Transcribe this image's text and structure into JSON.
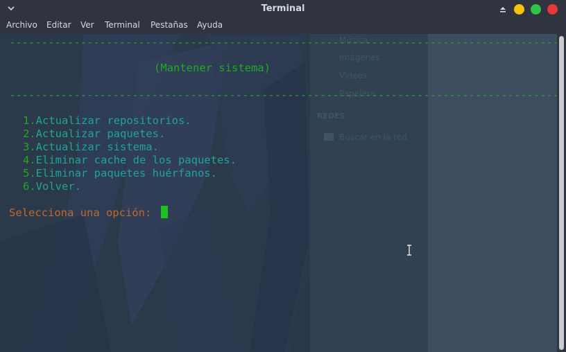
{
  "window": {
    "title": "Terminal",
    "colors": {
      "minimize": "#f5c211",
      "maximize": "#30c24b",
      "close": "#e5393b",
      "chrome": "#2f343f"
    }
  },
  "menubar": {
    "items": [
      "Archivo",
      "Editar",
      "Ver",
      "Terminal",
      "Pestañas",
      "Ayuda"
    ]
  },
  "background_ghost": {
    "items": [
      "Música",
      "Imágenes",
      "Vídeos",
      "Papelera"
    ],
    "section": "REDES",
    "network_item": "Buscar en la red"
  },
  "terminal": {
    "rule": "-------------------------------------------------------------------------------------",
    "heading": "(Mantener sistema)",
    "options": [
      {
        "num": "1.",
        "label": "Actualizar repositorios."
      },
      {
        "num": "2.",
        "label": "Actualizar paquetes."
      },
      {
        "num": "3.",
        "label": "Actualizar sistema."
      },
      {
        "num": "4.",
        "label": "Eliminar cache de los paquetes."
      },
      {
        "num": "5.",
        "label": "Eliminar paquetes huérfanos."
      },
      {
        "num": "6.",
        "label": "Volver."
      }
    ],
    "prompt": "Selecciona una opción: ",
    "colors": {
      "rule": "#1faa1f",
      "number": "#1faa1f",
      "option": "#20a39b",
      "prompt": "#c0682e",
      "cursor": "#1ec21e"
    }
  }
}
